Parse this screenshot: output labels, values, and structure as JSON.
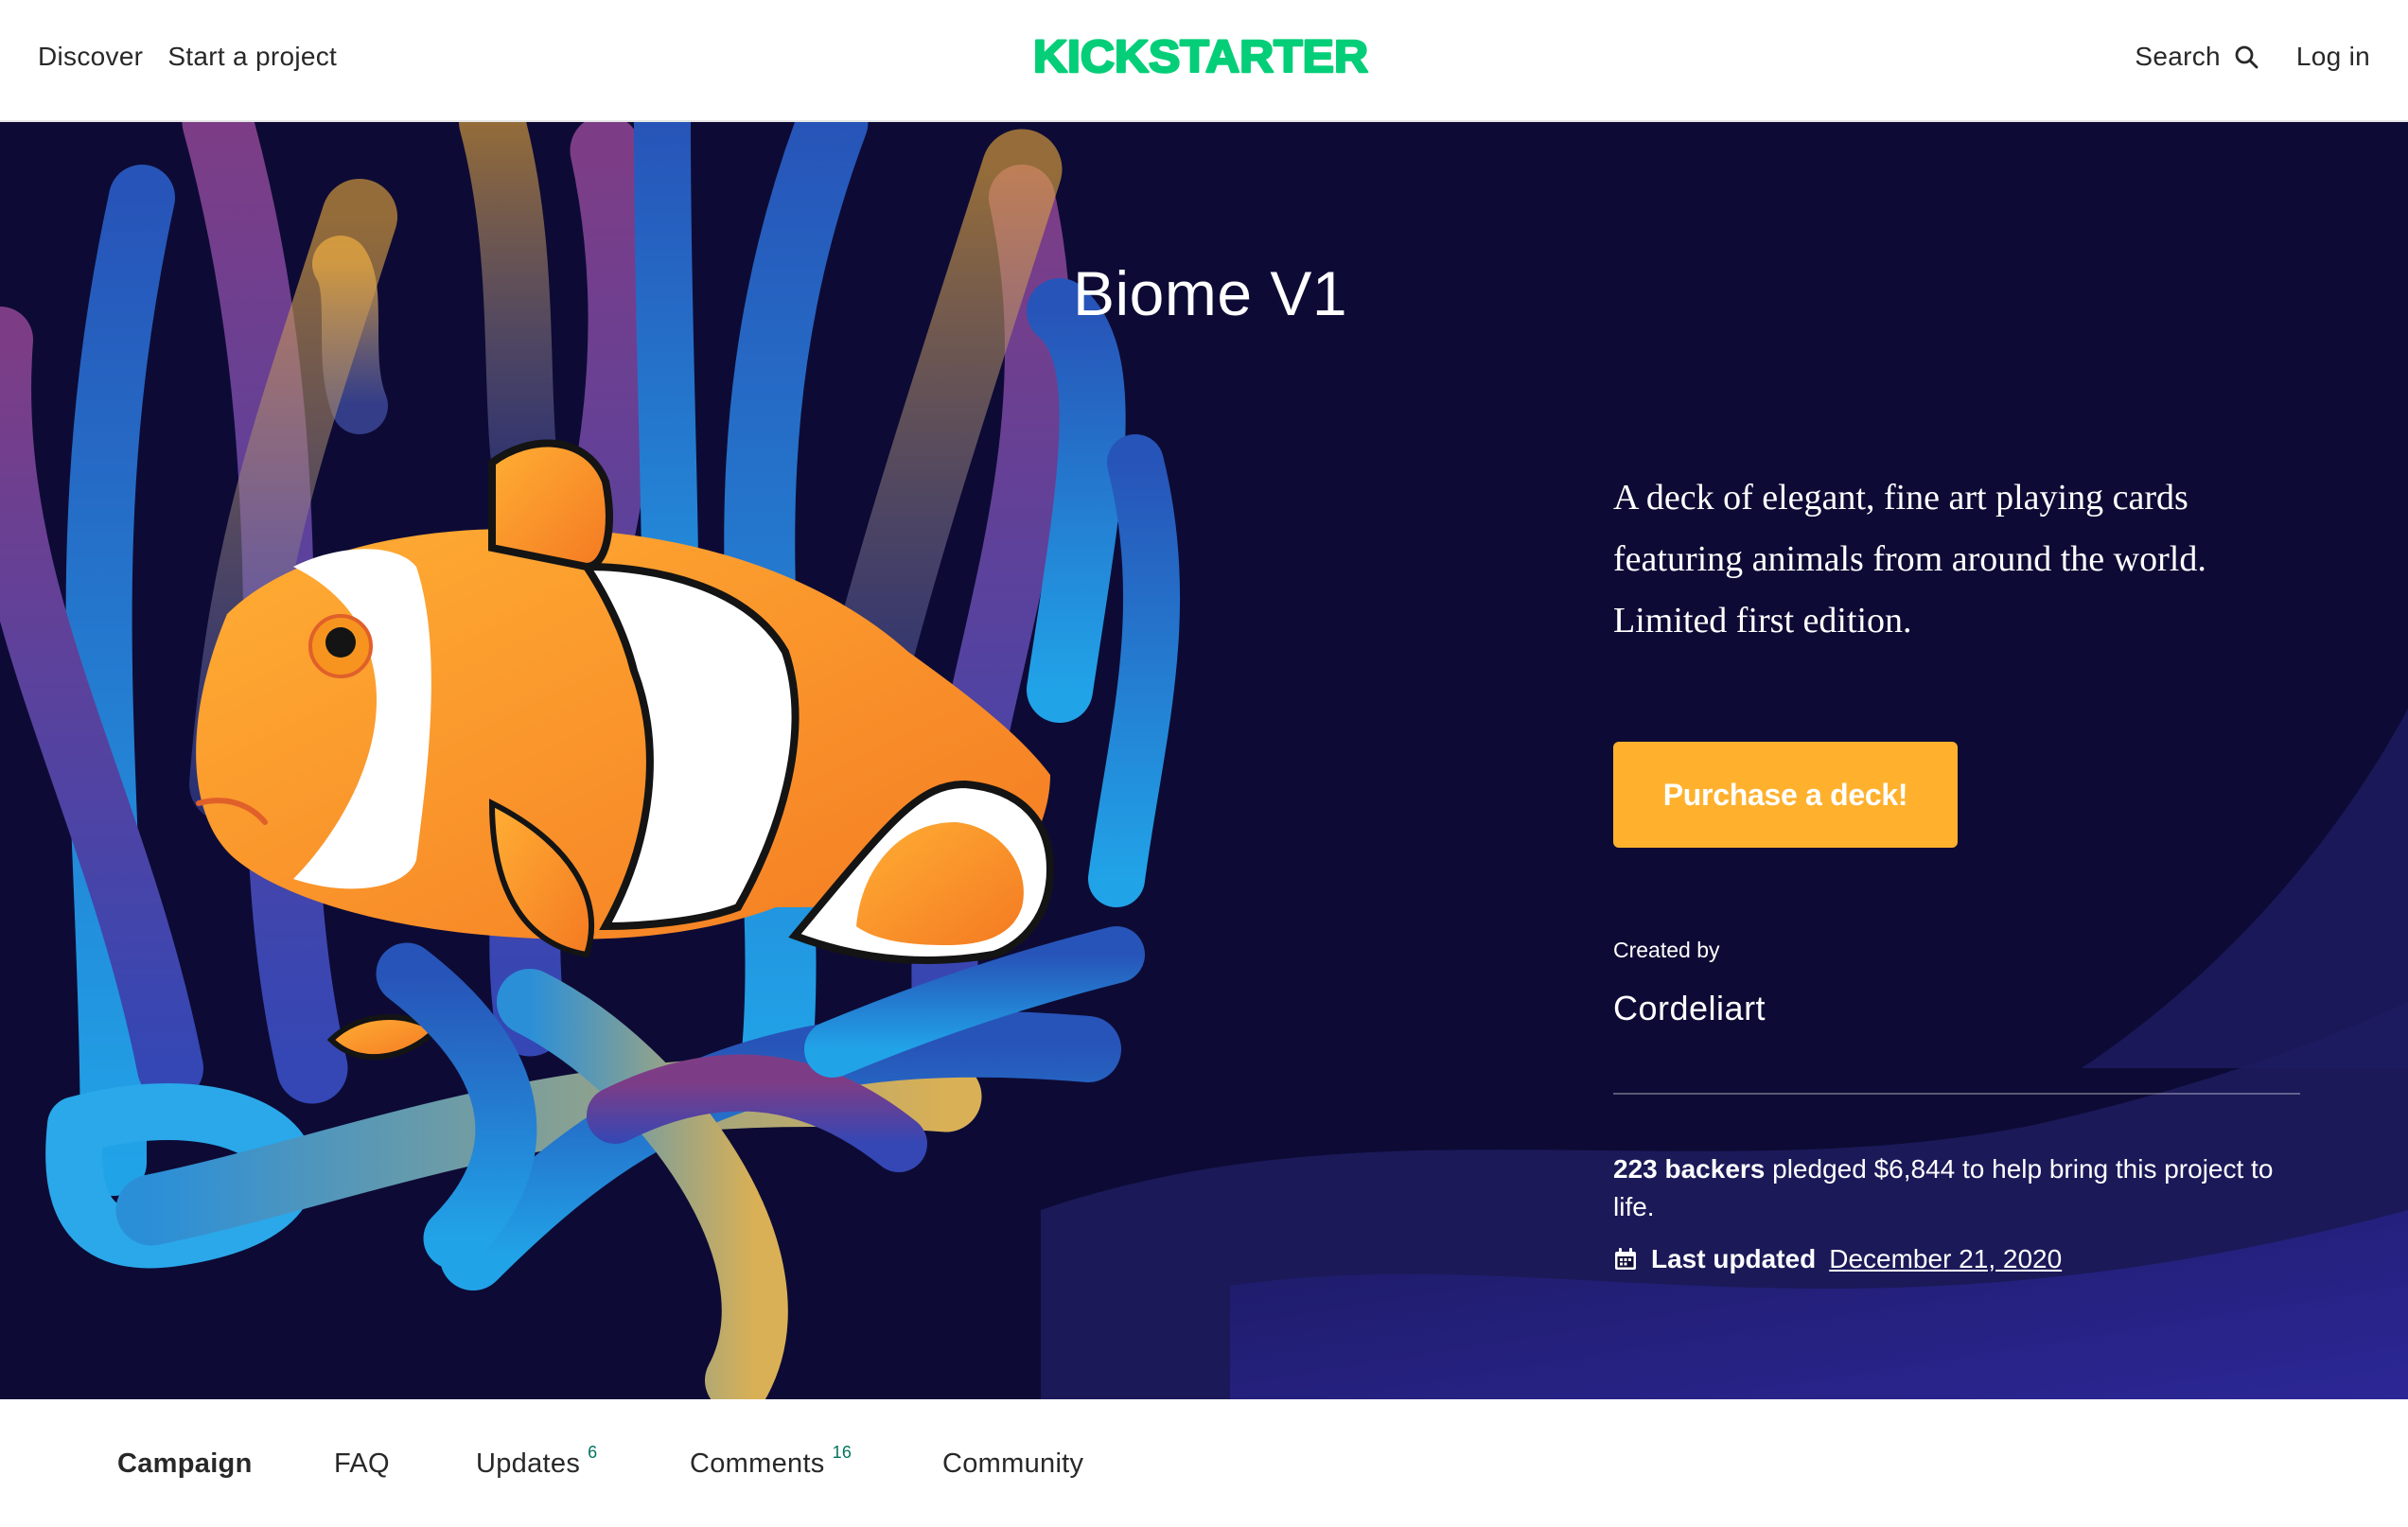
{
  "header": {
    "nav_left": [
      "Discover",
      "Start a project"
    ],
    "brand": "KICKSTARTER",
    "brand_color": "#05ce78",
    "search_label": "Search",
    "login_label": "Log in"
  },
  "hero": {
    "title": "Biome V1",
    "blurb_lines": [
      "A deck of elegant, fine art playing cards",
      "featuring animals from around the world.",
      "Limited first edition."
    ],
    "cta_label": "Purchase a deck!",
    "cta_color": "#ffb12e",
    "created_by_label": "Created by",
    "creator": "Cordeliart",
    "backers": "223 backers",
    "pledged_text": " pledged $6,844 to help bring this project to life.",
    "last_updated_label": "Last updated",
    "last_updated_date": "December 21, 2020",
    "calendar_icon": "calendar-icon",
    "background_color": "#0d0b35"
  },
  "tabs": [
    {
      "label": "Campaign",
      "count": ""
    },
    {
      "label": "FAQ",
      "count": ""
    },
    {
      "label": "Updates",
      "count": "6"
    },
    {
      "label": "Comments",
      "count": "16"
    },
    {
      "label": "Community",
      "count": ""
    }
  ]
}
